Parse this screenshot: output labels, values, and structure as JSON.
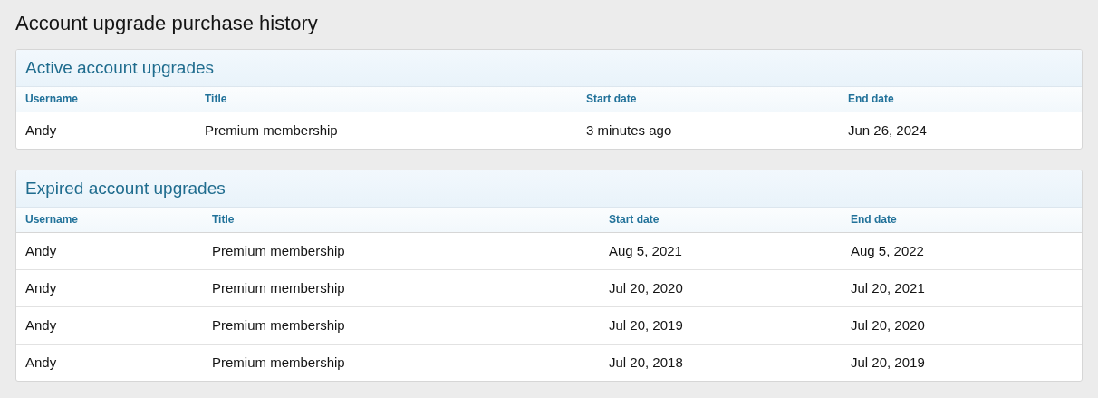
{
  "page": {
    "title": "Account upgrade purchase history"
  },
  "sections": [
    {
      "title": "Active account upgrades",
      "columns": [
        "Username",
        "Title",
        "Start date",
        "End date"
      ],
      "rows": [
        [
          "Andy",
          "Premium membership",
          "3 minutes ago",
          "Jun 26, 2024"
        ]
      ]
    },
    {
      "title": "Expired account upgrades",
      "columns": [
        "Username",
        "Title",
        "Start date",
        "End date"
      ],
      "rows": [
        [
          "Andy",
          "Premium membership",
          "Aug 5, 2021",
          "Aug 5, 2022"
        ],
        [
          "Andy",
          "Premium membership",
          "Jul 20, 2020",
          "Jul 20, 2021"
        ],
        [
          "Andy",
          "Premium membership",
          "Jul 20, 2019",
          "Jul 20, 2020"
        ],
        [
          "Andy",
          "Premium membership",
          "Jul 20, 2018",
          "Jul 20, 2019"
        ]
      ]
    }
  ]
}
